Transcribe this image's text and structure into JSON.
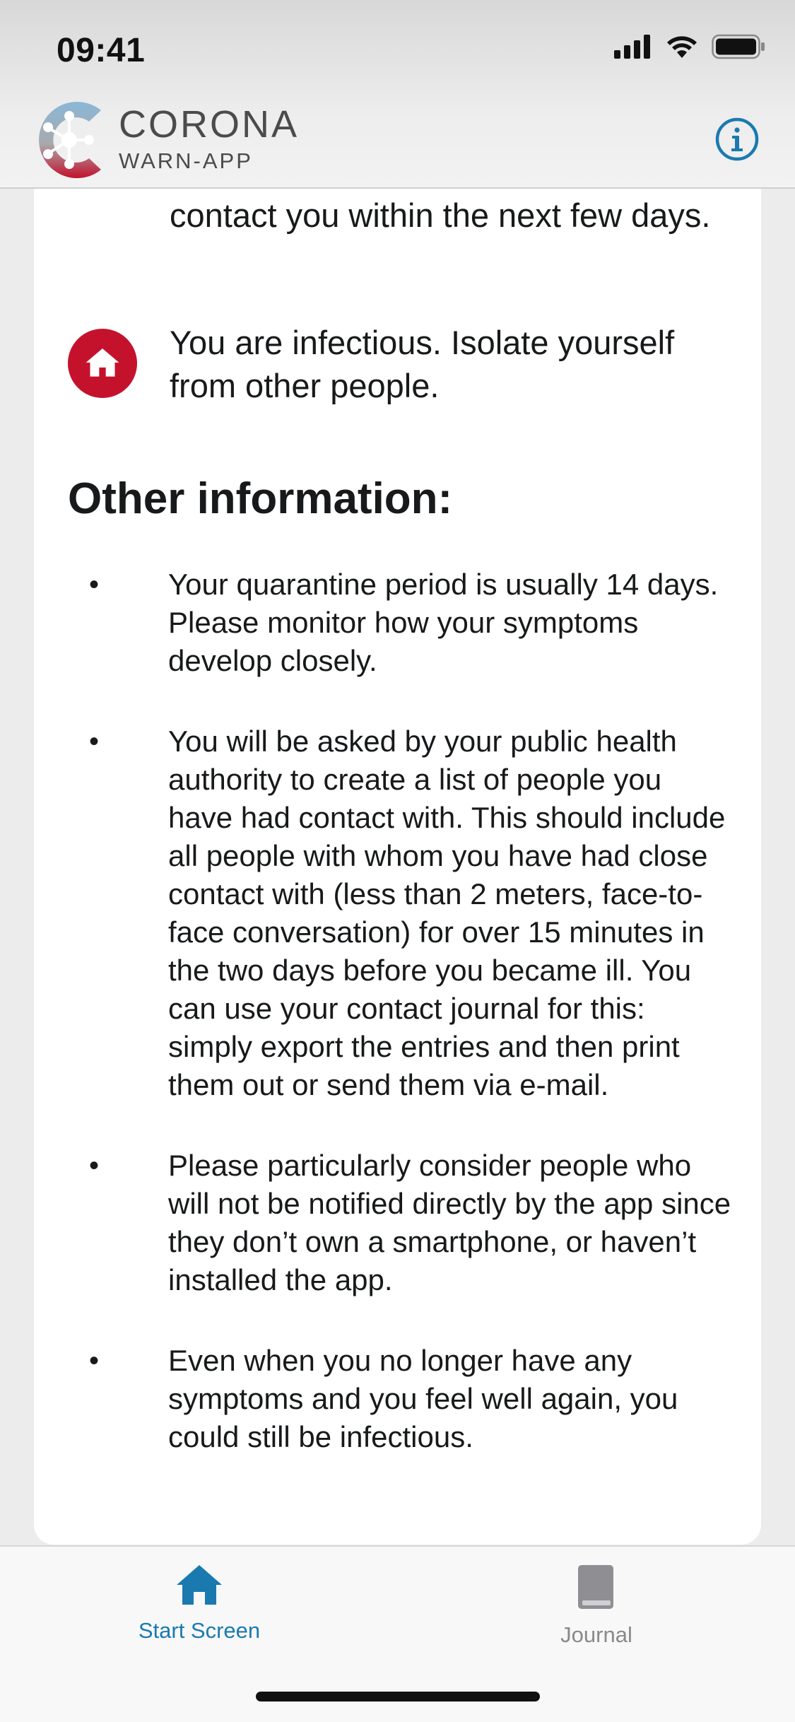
{
  "status_bar": {
    "time": "09:41",
    "icons": [
      "signal-icon",
      "wifi-icon",
      "battery-icon"
    ]
  },
  "header": {
    "logo_title": "CORONA",
    "logo_subtitle": "WARN-APP",
    "info_icon": "info-icon"
  },
  "rows": [
    {
      "icon": "phone-icon",
      "text": "contact you within the next few days."
    },
    {
      "icon": "home-icon",
      "text": "You are infectious. Isolate yourself from other people."
    }
  ],
  "other_info": {
    "title": "Other information:",
    "items": [
      "Your quarantine period is usually 14 days. Please monitor how your symptoms develop closely.",
      "You will be asked by your public health authority to create a list of people you have had contact with. This should include all people with whom you have had close contact with (less than 2 meters, face-to-face conversation) for over 15 minutes in the two days before you became ill. You can use your contact journal for this: simply export the entries and then print them out or send them via e-mail.",
      "Please particularly consider people who will not be notified directly by the app since they don’t own a smartphone, or haven’t installed the app.",
      "Even when you no longer have any symptoms and you feel well again, you could still be infectious."
    ]
  },
  "tab_bar": {
    "home_label": "Start Screen",
    "journal_label": "Journal"
  },
  "colors": {
    "accent_blue": "#1a7ab0",
    "alert_red": "#c5122c"
  }
}
